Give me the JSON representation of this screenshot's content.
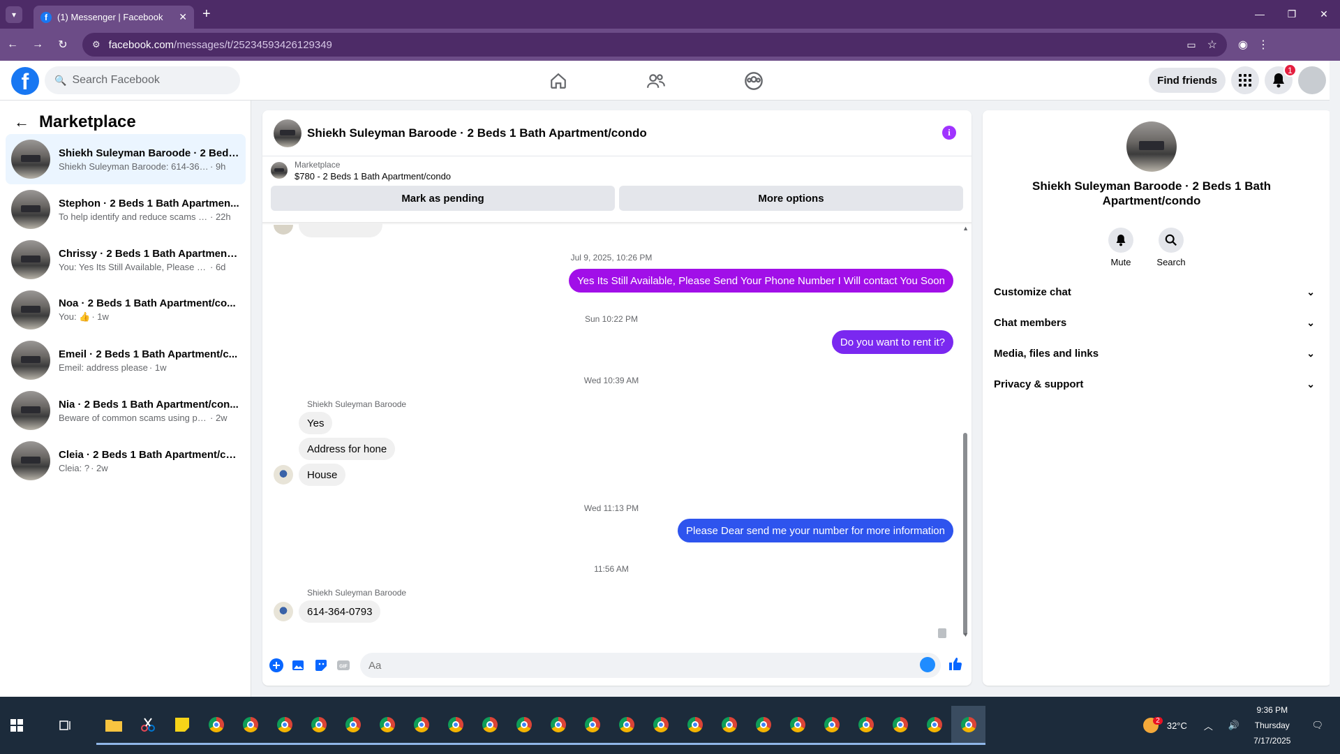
{
  "browser": {
    "tab_title": "(1) Messenger | Facebook",
    "url_domain": "facebook.com",
    "url_path": "/messages/t/25234593426129349"
  },
  "fbnav": {
    "search_placeholder": "Search Facebook",
    "find_friends": "Find friends",
    "notifications_count": "1"
  },
  "sidebar": {
    "title": "Marketplace",
    "conversations": [
      {
        "name": "Shiekh Suleyman Baroode · 2 Beds...",
        "preview": "Shiekh Suleyman Baroode: 614-364-0...",
        "time": "· 9h",
        "active": true
      },
      {
        "name": "Stephon · 2 Beds 1 Bath Apartmen...",
        "preview": "To help identify and reduce scams an...",
        "time": "· 22h"
      },
      {
        "name": "Chrissy · 2 Beds 1 Bath Apartment/...",
        "preview": "You: Yes Its Still Available, Please Send...",
        "time": "· 6d"
      },
      {
        "name": "Noa · 2 Beds 1 Bath Apartment/co...",
        "preview": "You: 👍",
        "time": "· 1w"
      },
      {
        "name": "Emeil · 2 Beds 1 Bath Apartment/c...",
        "preview": "Emeil: address please",
        "time": "· 1w"
      },
      {
        "name": "Nia · 2 Beds 1 Bath Apartment/con...",
        "preview": "Beware of common scams using pay...",
        "time": "· 2w"
      },
      {
        "name": "Cleia · 2 Beds 1 Bath Apartment/co...",
        "preview": "Cleia: ?",
        "time": "· 2w"
      }
    ]
  },
  "chat": {
    "title": "Shiekh Suleyman Baroode · 2 Beds 1 Bath Apartment/condo",
    "listing_category": "Marketplace",
    "listing_title": "$780 - 2 Beds 1 Bath Apartment/condo",
    "mark_pending": "Mark as pending",
    "more_options": "More options",
    "messages": {
      "ts1": "Jul 9, 2025, 10:26 PM",
      "out1": "Yes Its Still Available, Please Send Your Phone Number I Will contact You Soon",
      "ts2": "Sun 10:22 PM",
      "out2": "Do you want to rent it?",
      "ts3": "Wed 10:39 AM",
      "sender1": "Shiekh Suleyman Baroode",
      "in1": "Yes",
      "in2": "Address for hone",
      "in3": "House",
      "ts4": "Wed 11:13 PM",
      "out3": "Please Dear send me your number for more information",
      "ts5": "11:56 AM",
      "sender2": "Shiekh Suleyman Baroode",
      "in4": "614-364-0793"
    },
    "composer_placeholder": "Aa"
  },
  "info": {
    "name": "Shiekh Suleyman Baroode · 2 Beds 1 Bath Apartment/condo",
    "mute": "Mute",
    "search": "Search",
    "sections": [
      "Customize chat",
      "Chat members",
      "Media, files and links",
      "Privacy & support"
    ]
  },
  "taskbar": {
    "temperature": "32°C",
    "weather_badge": "2",
    "time": "9:36 PM",
    "day": "Thursday",
    "date": "7/17/2025"
  },
  "colors": {
    "browser_frame": "#4d2b67",
    "outgoing_purple": "#a10fe8",
    "outgoing_violet": "#7a28f0",
    "outgoing_blue": "#2e54ee",
    "fb_blue": "#1877f2"
  }
}
